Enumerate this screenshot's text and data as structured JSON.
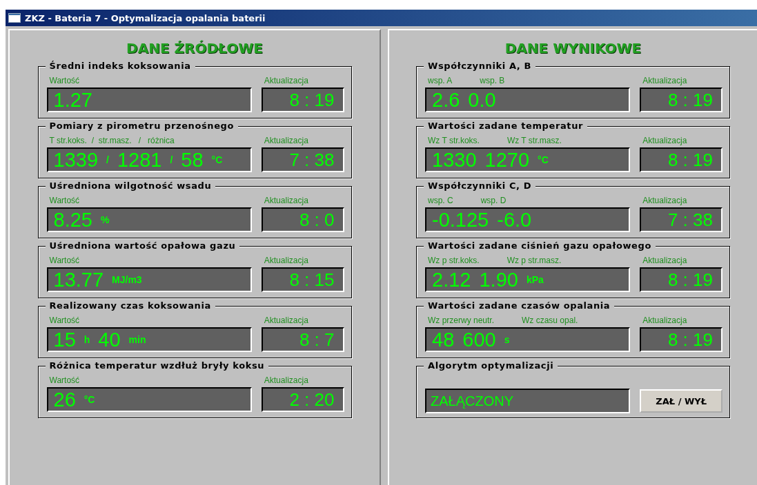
{
  "window": {
    "title": "ZKZ - Bateria 7 - Optymalizacja opalania baterii"
  },
  "panels": [
    {
      "title": "DANE ŹRÓDŁOWE",
      "groups": [
        {
          "kind": "display",
          "title": "Średni indeks koksowania",
          "labels": [
            "Wartość"
          ],
          "values": [
            {
              "kind": "num",
              "text": "1.27"
            }
          ],
          "update_label": "Aktualizacja",
          "time": "8 : 19"
        },
        {
          "kind": "display",
          "title": "Pomiary z pirometru przenośnego",
          "labels": [
            "T str.koks.  /  str.masz.   /   różnica"
          ],
          "values": [
            {
              "kind": "num",
              "text": "1339"
            },
            {
              "kind": "unit",
              "text": "/"
            },
            {
              "kind": "num",
              "text": "1281"
            },
            {
              "kind": "unit",
              "text": "/"
            },
            {
              "kind": "num",
              "text": "58"
            },
            {
              "kind": "unit",
              "text": "°C"
            }
          ],
          "update_label": "Aktualizacja",
          "time": "7 : 38"
        },
        {
          "kind": "display",
          "title": "Uśredniona wilgotność wsadu",
          "labels": [
            "Wartość"
          ],
          "values": [
            {
              "kind": "num",
              "text": "8.25"
            },
            {
              "kind": "unit",
              "text": "%"
            }
          ],
          "update_label": "Aktualizacja",
          "time": "8 : 0"
        },
        {
          "kind": "display",
          "title": "Uśredniona wartość opałowa gazu",
          "labels": [
            "Wartość"
          ],
          "values": [
            {
              "kind": "num",
              "text": "13.77"
            },
            {
              "kind": "unit",
              "text": "MJ/m3"
            }
          ],
          "update_label": "Aktualizacja",
          "time": "8 : 15"
        },
        {
          "kind": "display",
          "title": "Realizowany czas koksowania",
          "labels": [
            "Wartość"
          ],
          "values": [
            {
              "kind": "num",
              "text": "15"
            },
            {
              "kind": "unit",
              "text": "h"
            },
            {
              "kind": "num",
              "text": "40"
            },
            {
              "kind": "unit",
              "text": "min"
            }
          ],
          "update_label": "Aktualizacja",
          "time": "8 : 7"
        },
        {
          "kind": "display",
          "title": "Różnica temperatur wzdłuż bryły koksu",
          "labels": [
            "Wartość"
          ],
          "values": [
            {
              "kind": "num",
              "text": "26"
            },
            {
              "kind": "unit",
              "text": "°C"
            }
          ],
          "update_label": "Aktualizacja",
          "time": "2 : 20"
        }
      ]
    },
    {
      "title": "DANE WYNIKOWE",
      "groups": [
        {
          "kind": "display",
          "title": "Współczynniki A, B",
          "labels": [
            "wsp. A",
            "wsp. B"
          ],
          "values": [
            {
              "kind": "num",
              "text": "2.6"
            },
            {
              "kind": "num",
              "text": "0.0"
            }
          ],
          "update_label": "Aktualizacja",
          "time": "8 : 19"
        },
        {
          "kind": "display",
          "title": "Wartości zadane temperatur",
          "labels": [
            "Wz T str.koks.",
            "Wz T str.masz."
          ],
          "values": [
            {
              "kind": "num",
              "text": "1330"
            },
            {
              "kind": "num",
              "text": "1270"
            },
            {
              "kind": "unit",
              "text": "°C"
            }
          ],
          "update_label": "Aktualizacja",
          "time": "8 : 19"
        },
        {
          "kind": "display",
          "title": "Współczynniki C, D",
          "labels": [
            "wsp. C",
            "wsp. D"
          ],
          "values": [
            {
              "kind": "num",
              "text": "-0.125"
            },
            {
              "kind": "num",
              "text": "-6.0"
            }
          ],
          "update_label": "Aktualizacja",
          "time": "7 : 38"
        },
        {
          "kind": "display",
          "title": "Wartości zadane ciśnień gazu opałowego",
          "labels": [
            "Wz p str.koks.",
            "Wz p str.masz."
          ],
          "values": [
            {
              "kind": "num",
              "text": "2.12"
            },
            {
              "kind": "num",
              "text": "1.90"
            },
            {
              "kind": "unit",
              "text": "kPa"
            }
          ],
          "update_label": "Aktualizacja",
          "time": "8 : 19"
        },
        {
          "kind": "display",
          "title": "Wartości zadane czasów opalania",
          "labels": [
            "Wz przerwy neutr.",
            "Wz czasu opal."
          ],
          "values": [
            {
              "kind": "num",
              "text": "48"
            },
            {
              "kind": "num",
              "text": "600"
            },
            {
              "kind": "unit",
              "text": "s"
            }
          ],
          "update_label": "Aktualizacja",
          "time": "8 : 19"
        },
        {
          "kind": "toggle",
          "title": "Algorytm optymalizacji",
          "status": "ZAŁĄCZONY",
          "button": "ZAŁ / WYŁ"
        }
      ]
    }
  ]
}
